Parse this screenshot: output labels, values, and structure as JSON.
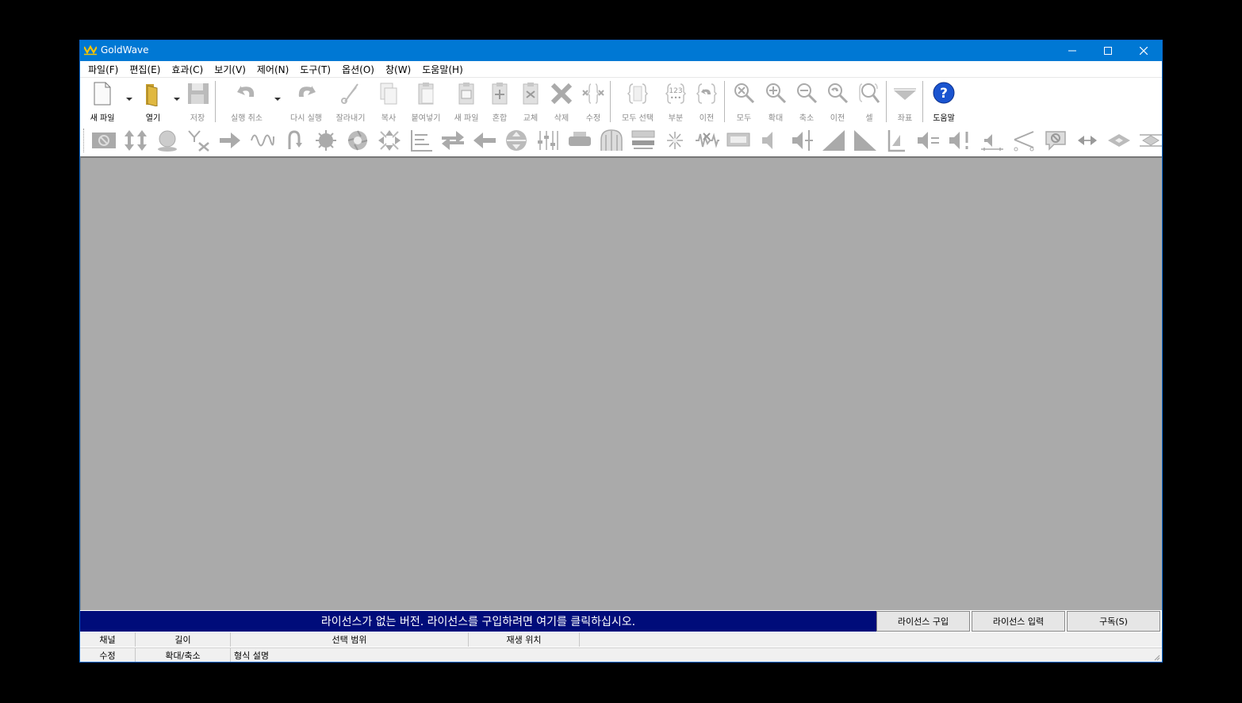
{
  "window": {
    "title": "GoldWave",
    "accent": "#0078d4",
    "canvas_color": "#aaaaaa",
    "license_bar_color": "#000c7a"
  },
  "menu": [
    "파일(F)",
    "편집(E)",
    "효과(C)",
    "보기(V)",
    "제어(N)",
    "도구(T)",
    "옵션(O)",
    "창(W)",
    "도움말(H)"
  ],
  "toolbar": {
    "new": "새 파일",
    "open": "열기",
    "save": "저장",
    "undo": "실행 취소",
    "redo": "다시 실행",
    "cut": "잘라내기",
    "copy": "복사",
    "paste": "붙여넣기",
    "paste_new": "새 파일",
    "mix": "혼합",
    "replace": "교체",
    "delete": "삭제",
    "trim": "수정",
    "select_all": "모두 선택",
    "set": "부분",
    "prev_sel": "이전",
    "zoom_all": "모두",
    "zoom_in": "확대",
    "zoom_out": "축소",
    "zoom_prev": "이전",
    "zoom_cell": "셀",
    "marks": "좌표",
    "help": "도움말"
  },
  "license": {
    "message": "라이선스가 없는 버전. 라이선스를 구입하려면 여기를 클릭하십시오.",
    "buy": "라이선스 구입",
    "enter": "라이선스 입력",
    "subscribe": "구독(S)"
  },
  "status": {
    "row1": [
      "채널",
      "길이",
      "선택 범위",
      "재생 위치"
    ],
    "row2": [
      "수정",
      "확대/축소",
      "형식 설명"
    ]
  }
}
